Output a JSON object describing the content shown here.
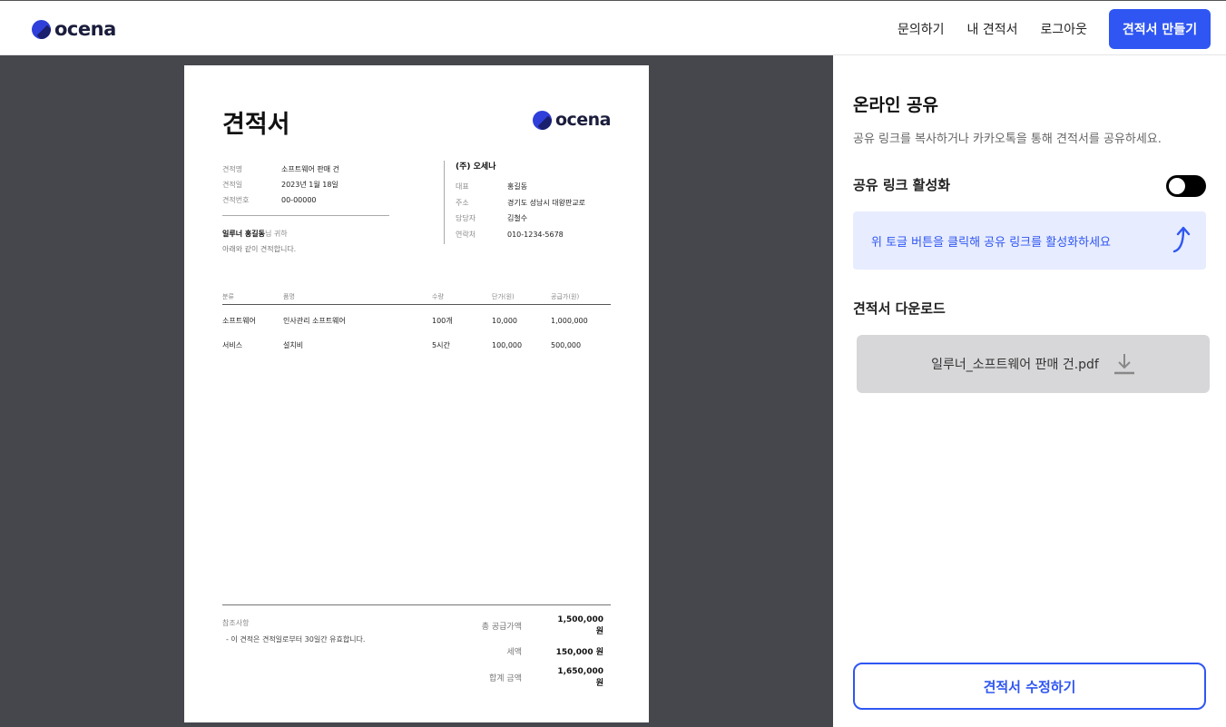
{
  "header": {
    "brand": "ocena",
    "nav": [
      "문의하기",
      "내 견적서",
      "로그아웃"
    ],
    "cta": "견적서 만들기"
  },
  "quote": {
    "title": "견적서",
    "brand": "ocena",
    "info": [
      {
        "label": "견적명",
        "value": "소프트웨어 판매 건"
      },
      {
        "label": "견적일",
        "value": "2023년 1월 18일"
      },
      {
        "label": "견적번호",
        "value": "00-00000"
      }
    ],
    "recipient_name": "일루너 홍길동",
    "recipient_suffix": "님 귀하",
    "recipient_note": "아래와 같이 견적합니다.",
    "supplier": {
      "name": "(주) 오세나",
      "rows": [
        {
          "label": "대표",
          "value": "홍길동"
        },
        {
          "label": "주소",
          "value": "경기도 성남시 대왕판교로"
        },
        {
          "label": "담당자",
          "value": "김철수"
        },
        {
          "label": "연락처",
          "value": "010-1234-5678"
        }
      ]
    },
    "columns": [
      "분류",
      "품명",
      "수량",
      "단가(원)",
      "공급가(원)"
    ],
    "items": [
      [
        "소프트웨어",
        "인사관리 소프트웨어",
        "100개",
        "10,000",
        "1,000,000"
      ],
      [
        "서비스",
        "설치비",
        "5시간",
        "100,000",
        "500,000"
      ]
    ],
    "notes_title": "참조사항",
    "notes_body": "- 이 견적은 견적일로부터 30일간 유효합니다.",
    "totals": [
      {
        "label": "총 공급가액",
        "value": "1,500,000 원"
      },
      {
        "label": "세액",
        "value": "150,000 원"
      },
      {
        "label": "합계 금액",
        "value": "1,650,000 원"
      }
    ]
  },
  "panel": {
    "title": "온라인 공유",
    "subtitle": "공유 링크를 복사하거나 카카오톡을 통해 견적서를 공유하세요.",
    "toggle_label": "공유 링크 활성화",
    "toggle_on": false,
    "hint": "위 토글 버튼을 클릭해 공유 링크를 활성화하세요",
    "download_label": "견적서 다운로드",
    "file_name": "일루너_소프트웨어 판매 건.pdf",
    "edit_button": "견적서 수정하기",
    "colors": {
      "accent": "#2f56f2",
      "hint_bg": "#e7ecff",
      "preview_bg": "#46474d"
    }
  }
}
